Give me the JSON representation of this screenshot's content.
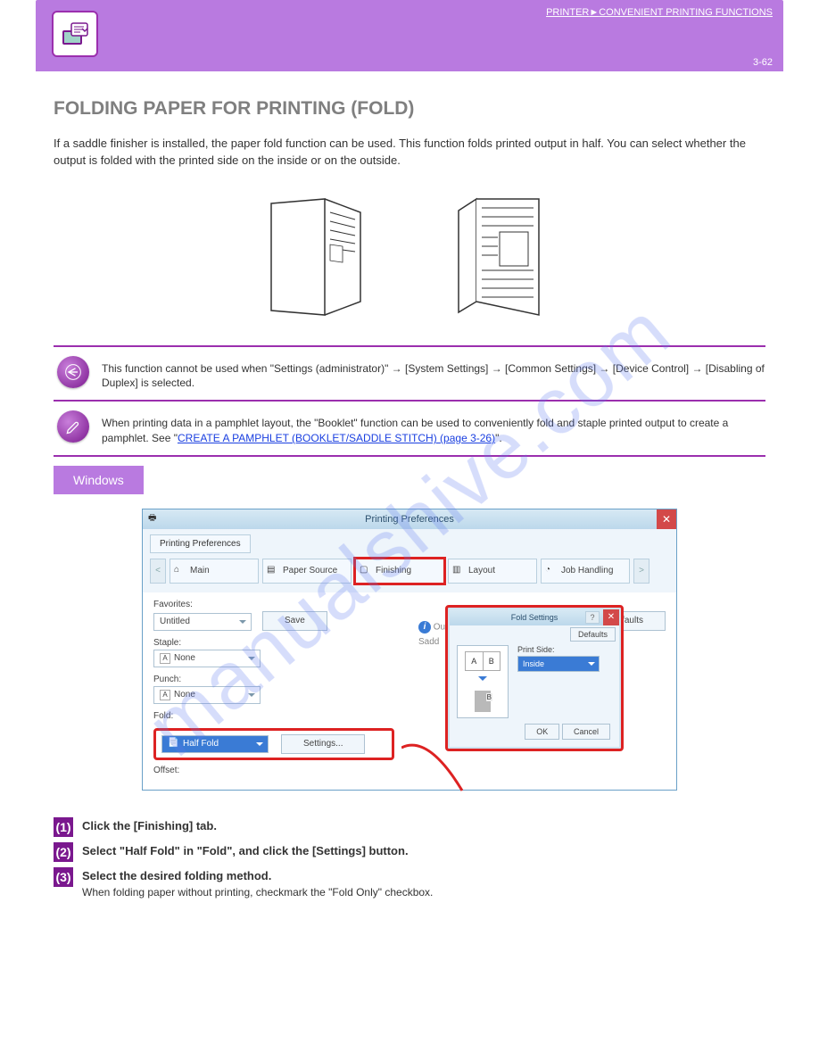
{
  "header": {
    "topic_link": "PRINTER",
    "chapter_link": "CONVENIENT PRINTING FUNCTIONS",
    "page_number": "3-62"
  },
  "watermark": "manualshive.com",
  "section_title": "FOLDING PAPER FOR PRINTING (FOLD)",
  "intro": "If a saddle finisher is installed, the paper fold function can be used. This function folds printed output in half. You can select whether the output is folded with the printed side on the inside or on the outside.",
  "note1": "This function cannot be used when \"Settings (administrator)\" → [System Settings] → [Common Settings] → [Device Control] → [Disabling of Duplex] is selected.",
  "note2_prefix": "When printing data in a pamphlet layout, the \"Booklet\" function can be used to conveniently fold and staple printed output to create a pamphlet. See \"",
  "note2_link": "CREATE A PAMPHLET (BOOKLET/SADDLE STITCH) (page 3-26)",
  "note2_suffix": "\".",
  "os_tab": "Windows",
  "screenshot": {
    "window_title": "Printing Preferences",
    "tab_title": "Printing Preferences",
    "nav_prev": "<",
    "nav_next": ">",
    "tabs": {
      "main": "Main",
      "paper_source": "Paper Source",
      "finishing": "Finishing",
      "layout": "Layout",
      "job_handling": "Job Handling"
    },
    "favorites_label": "Favorites:",
    "favorites_value": "Untitled",
    "save_btn": "Save",
    "defaults_btn": "Defaults",
    "staple_label": "Staple:",
    "staple_value": "None",
    "punch_label": "Punch:",
    "punch_value": "None",
    "fold_label": "Fold:",
    "fold_value": "Half Fold",
    "settings_btn": "Settings...",
    "offset_label": "Offset:",
    "output_label": "Outpu",
    "saddle_label": "Sadd",
    "popup": {
      "title": "Fold Settings",
      "defaults_btn": "Defaults",
      "print_side_label": "Print Side:",
      "print_side_value": "Inside",
      "a": "A",
      "b": "B",
      "ok": "OK",
      "cancel": "Cancel"
    }
  },
  "steps": {
    "s1": {
      "num": "(1)",
      "heading": "Click the [Finishing] tab."
    },
    "s2": {
      "num": "(2)",
      "heading": "Select \"Half Fold\" in \"Fold\", and click the [Settings] button."
    },
    "s3": {
      "num": "(3)",
      "heading": "Select the desired folding method.",
      "sub": "When folding paper without printing, checkmark the \"Fold Only\" checkbox."
    }
  }
}
